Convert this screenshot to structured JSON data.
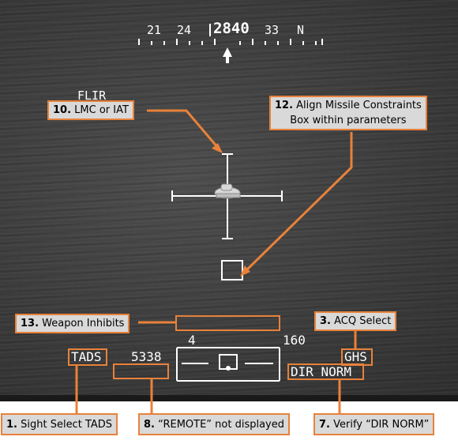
{
  "heading_tape": {
    "labels": [
      "21",
      "24",
      "2840",
      "33",
      "N"
    ]
  },
  "symbology": {
    "flir_label": "FLIR",
    "sight": "TADS",
    "range": "5338",
    "acq": "GHS",
    "mode": "DIR NORM",
    "tape_low": "4",
    "tape_high": "160"
  },
  "callouts": {
    "c1": {
      "num": "1.",
      "text": " Sight Select TADS"
    },
    "c3": {
      "num": "3.",
      "text": " ACQ Select"
    },
    "c7": {
      "num": "7.",
      "text": " Verify “DIR NORM”"
    },
    "c8": {
      "num": "8.",
      "text": " “REMOTE” not displayed"
    },
    "c10": {
      "num": "10.",
      "text": " LMC or IAT"
    },
    "c12": {
      "num": "12.",
      "text": " Align Missile Constraints",
      "text2": "Box within parameters"
    },
    "c13": {
      "num": "13.",
      "text": " Weapon Inhibits"
    }
  },
  "colors": {
    "accent": "#e8823a",
    "callout_bg": "#d9d9d9",
    "symbology": "#ffffff"
  }
}
